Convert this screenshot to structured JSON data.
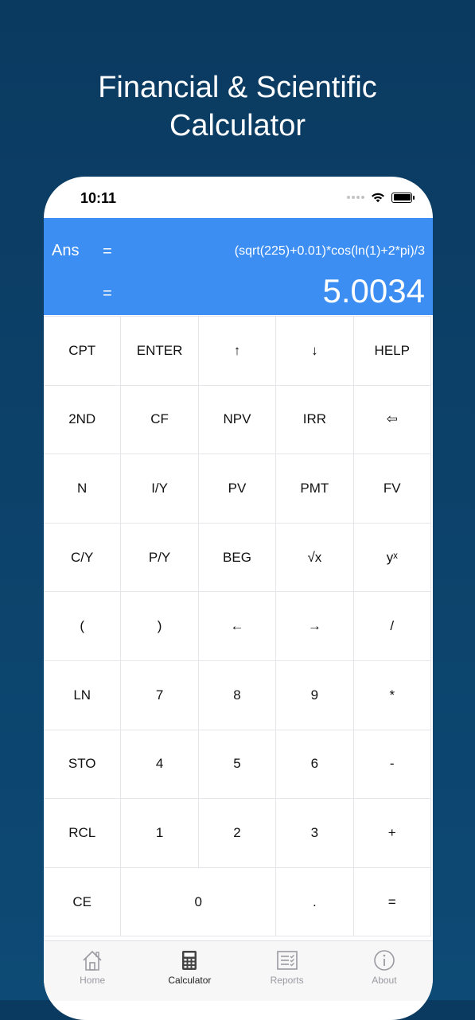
{
  "promo": {
    "title": "Financial & Scientific\nCalculator"
  },
  "status_bar": {
    "time": "10:11"
  },
  "display": {
    "ans_label": "Ans",
    "equals_1": "=",
    "expression": "(sqrt(225)+0.01)*cos(ln(1)+2*pi)/3",
    "equals_2": "=",
    "result": "5.0034"
  },
  "keys": [
    {
      "label": "CPT",
      "name": "key-cpt"
    },
    {
      "label": "ENTER",
      "name": "key-enter"
    },
    {
      "label": "↑",
      "name": "key-up-arrow"
    },
    {
      "label": "↓",
      "name": "key-down-arrow"
    },
    {
      "label": "HELP",
      "name": "key-help"
    },
    {
      "label": "2ND",
      "name": "key-2nd"
    },
    {
      "label": "CF",
      "name": "key-cf"
    },
    {
      "label": "NPV",
      "name": "key-npv"
    },
    {
      "label": "IRR",
      "name": "key-irr"
    },
    {
      "label": "⇦",
      "name": "key-backspace"
    },
    {
      "label": "N",
      "name": "key-n"
    },
    {
      "label": "I/Y",
      "name": "key-iy"
    },
    {
      "label": "PV",
      "name": "key-pv"
    },
    {
      "label": "PMT",
      "name": "key-pmt"
    },
    {
      "label": "FV",
      "name": "key-fv"
    },
    {
      "label": "C/Y",
      "name": "key-cy"
    },
    {
      "label": "P/Y",
      "name": "key-py"
    },
    {
      "label": "BEG",
      "name": "key-beg"
    },
    {
      "label": "√x",
      "name": "key-sqrt"
    },
    {
      "label": "yˣ",
      "name": "key-power"
    },
    {
      "label": "(",
      "name": "key-open-paren"
    },
    {
      "label": ")",
      "name": "key-close-paren"
    },
    {
      "label": "←",
      "name": "key-left-arrow"
    },
    {
      "label": "→",
      "name": "key-right-arrow"
    },
    {
      "label": "/",
      "name": "key-divide"
    },
    {
      "label": "LN",
      "name": "key-ln"
    },
    {
      "label": "7",
      "name": "key-7"
    },
    {
      "label": "8",
      "name": "key-8"
    },
    {
      "label": "9",
      "name": "key-9"
    },
    {
      "label": "*",
      "name": "key-multiply"
    },
    {
      "label": "STO",
      "name": "key-sto"
    },
    {
      "label": "4",
      "name": "key-4"
    },
    {
      "label": "5",
      "name": "key-5"
    },
    {
      "label": "6",
      "name": "key-6"
    },
    {
      "label": "-",
      "name": "key-minus"
    },
    {
      "label": "RCL",
      "name": "key-rcl"
    },
    {
      "label": "1",
      "name": "key-1"
    },
    {
      "label": "2",
      "name": "key-2"
    },
    {
      "label": "3",
      "name": "key-3"
    },
    {
      "label": "+",
      "name": "key-plus"
    },
    {
      "label": "CE",
      "name": "key-ce"
    },
    {
      "label": "0",
      "name": "key-0",
      "wide": true
    },
    {
      "label": ".",
      "name": "key-decimal"
    },
    {
      "label": "=",
      "name": "key-equals"
    }
  ],
  "tabs": [
    {
      "label": "Home",
      "icon": "home-icon",
      "active": false
    },
    {
      "label": "Calculator",
      "icon": "calculator-icon",
      "active": true
    },
    {
      "label": "Reports",
      "icon": "reports-icon",
      "active": false
    },
    {
      "label": "About",
      "icon": "info-icon",
      "active": false
    }
  ],
  "colors": {
    "background": "#0b3a60",
    "display": "#3c8ef3",
    "active_tab": "#222222",
    "inactive_tab": "#9a9aa0"
  }
}
